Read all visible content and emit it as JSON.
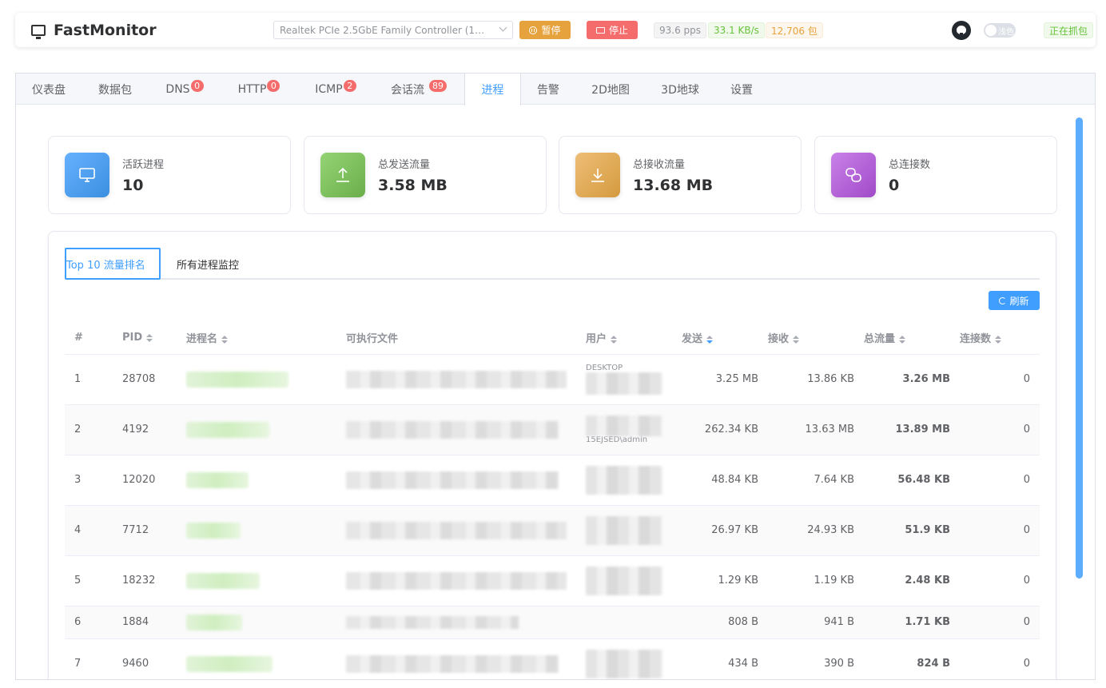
{
  "header": {
    "app_title": "FastMonitor",
    "interface": "Realtek PCIe 2.5GbE Family Controller (172.168.2...",
    "pause_label": "暂停",
    "stop_label": "停止",
    "pps": "93.6 pps",
    "rate": "33.1 KB/s",
    "packets": "12,706 包",
    "theme_label": "浅色",
    "capture_status": "正在抓包"
  },
  "tabs": [
    {
      "label": "仪表盘"
    },
    {
      "label": "数据包"
    },
    {
      "label": "DNS",
      "badge": "0"
    },
    {
      "label": "HTTP",
      "badge": "0"
    },
    {
      "label": "ICMP",
      "badge": "2"
    },
    {
      "label": "会话流",
      "badge": "89"
    },
    {
      "label": "进程",
      "active": true
    },
    {
      "label": "告警"
    },
    {
      "label": "2D地图"
    },
    {
      "label": "3D地球"
    },
    {
      "label": "设置"
    }
  ],
  "stats": [
    {
      "label": "活跃进程",
      "value": "10",
      "icon": "monitor-icon",
      "color": "#4a9fe8"
    },
    {
      "label": "总发送流量",
      "value": "3.58 MB",
      "icon": "upload-icon",
      "color": "#7dbb5f"
    },
    {
      "label": "总接收流量",
      "value": "13.68 MB",
      "icon": "download-icon",
      "color": "#e0ad57"
    },
    {
      "label": "总连接数",
      "value": "0",
      "icon": "link-icon",
      "color": "#b45fd6"
    }
  ],
  "process_panel": {
    "tab_top10": "Top 10 流量排名",
    "tab_all": "所有进程监控",
    "refresh_label": "刷新",
    "columns": [
      "#",
      "PID",
      "进程名",
      "可执行文件",
      "用户",
      "发送",
      "接收",
      "总流量",
      "连接数"
    ],
    "rows": [
      {
        "idx": "1",
        "pid": "28708",
        "user_hint": "DESKTOP",
        "send": "3.25 MB",
        "recv": "13.86 KB",
        "total": "3.26 MB",
        "conns": "0"
      },
      {
        "idx": "2",
        "pid": "4192",
        "user_hint": "15EJSED\\admin",
        "send": "262.34 KB",
        "recv": "13.63 MB",
        "total": "13.89 MB",
        "conns": "0"
      },
      {
        "idx": "3",
        "pid": "12020",
        "user_hint": "",
        "send": "48.84 KB",
        "recv": "7.64 KB",
        "total": "56.48 KB",
        "conns": "0"
      },
      {
        "idx": "4",
        "pid": "7712",
        "user_hint": "",
        "send": "26.97 KB",
        "recv": "24.93 KB",
        "total": "51.9 KB",
        "conns": "0"
      },
      {
        "idx": "5",
        "pid": "18232",
        "user_hint": "",
        "send": "1.29 KB",
        "recv": "1.19 KB",
        "total": "2.48 KB",
        "conns": "0"
      },
      {
        "idx": "6",
        "pid": "1884",
        "user_hint": "",
        "send": "808 B",
        "recv": "941 B",
        "total": "1.71 KB",
        "conns": "0"
      },
      {
        "idx": "7",
        "pid": "9460",
        "user_hint": "",
        "send": "434 B",
        "recv": "390 B",
        "total": "824 B",
        "conns": "0"
      }
    ]
  }
}
